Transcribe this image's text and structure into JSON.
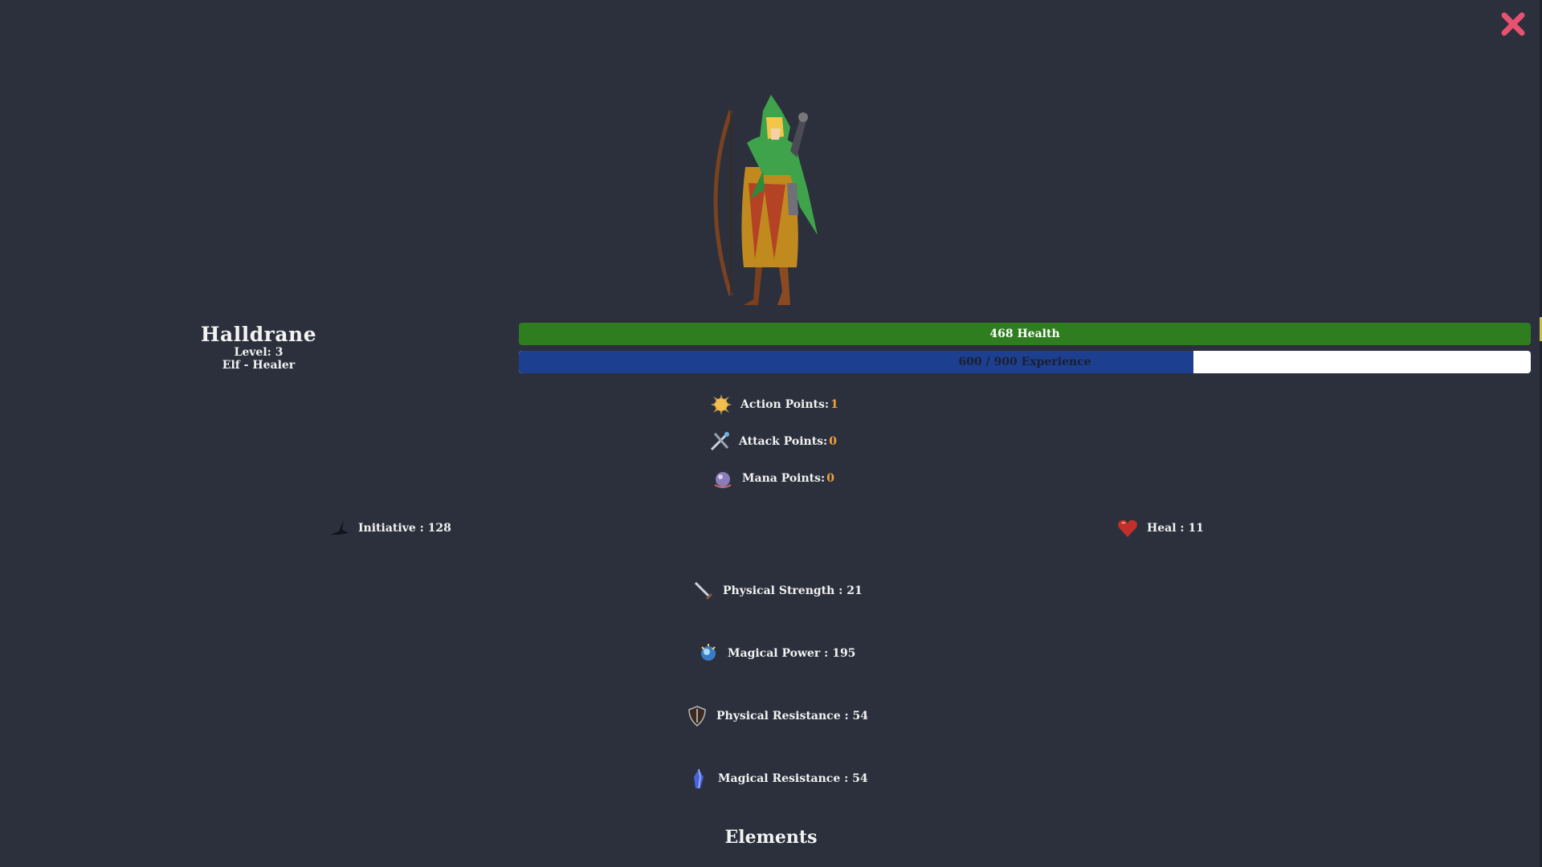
{
  "close_label": "Close",
  "character": {
    "name": "Halldrane",
    "level_text": "Level: 3",
    "race_class": "Elf - Healer"
  },
  "bars": {
    "health_text": "468 Health",
    "experience_text": "600 / 900 Experience",
    "experience_fraction": 0.667
  },
  "points": {
    "action": {
      "label": "Action Points:",
      "value": "1",
      "icon": "burst-icon"
    },
    "attack": {
      "label": "Attack Points:",
      "value": "0",
      "icon": "crossed-swords-icon"
    },
    "mana": {
      "label": "Mana Points:",
      "value": "0",
      "icon": "mana-orb-icon"
    }
  },
  "stats": {
    "initiative": {
      "text": "Initiative : 128",
      "icon": "bird-icon"
    },
    "heal": {
      "text": "Heal : 11",
      "icon": "heart-icon"
    },
    "physical_strength": {
      "text": "Physical Strength : 21",
      "icon": "sword-icon"
    },
    "magical_power": {
      "text": "Magical Power : 195",
      "icon": "magic-orb-icon"
    },
    "physical_resistance": {
      "text": "Physical Resistance : 54",
      "icon": "shield-icon"
    },
    "magical_resistance": {
      "text": "Magical Resistance : 54",
      "icon": "crystal-icon"
    }
  },
  "sections": {
    "elements_title": "Elements"
  },
  "colors": {
    "background": "#2b303c",
    "health": "#2e7d1e",
    "experience": "#1d3f8f",
    "accent_value": "#f2a23a",
    "close": "#e8516f"
  }
}
